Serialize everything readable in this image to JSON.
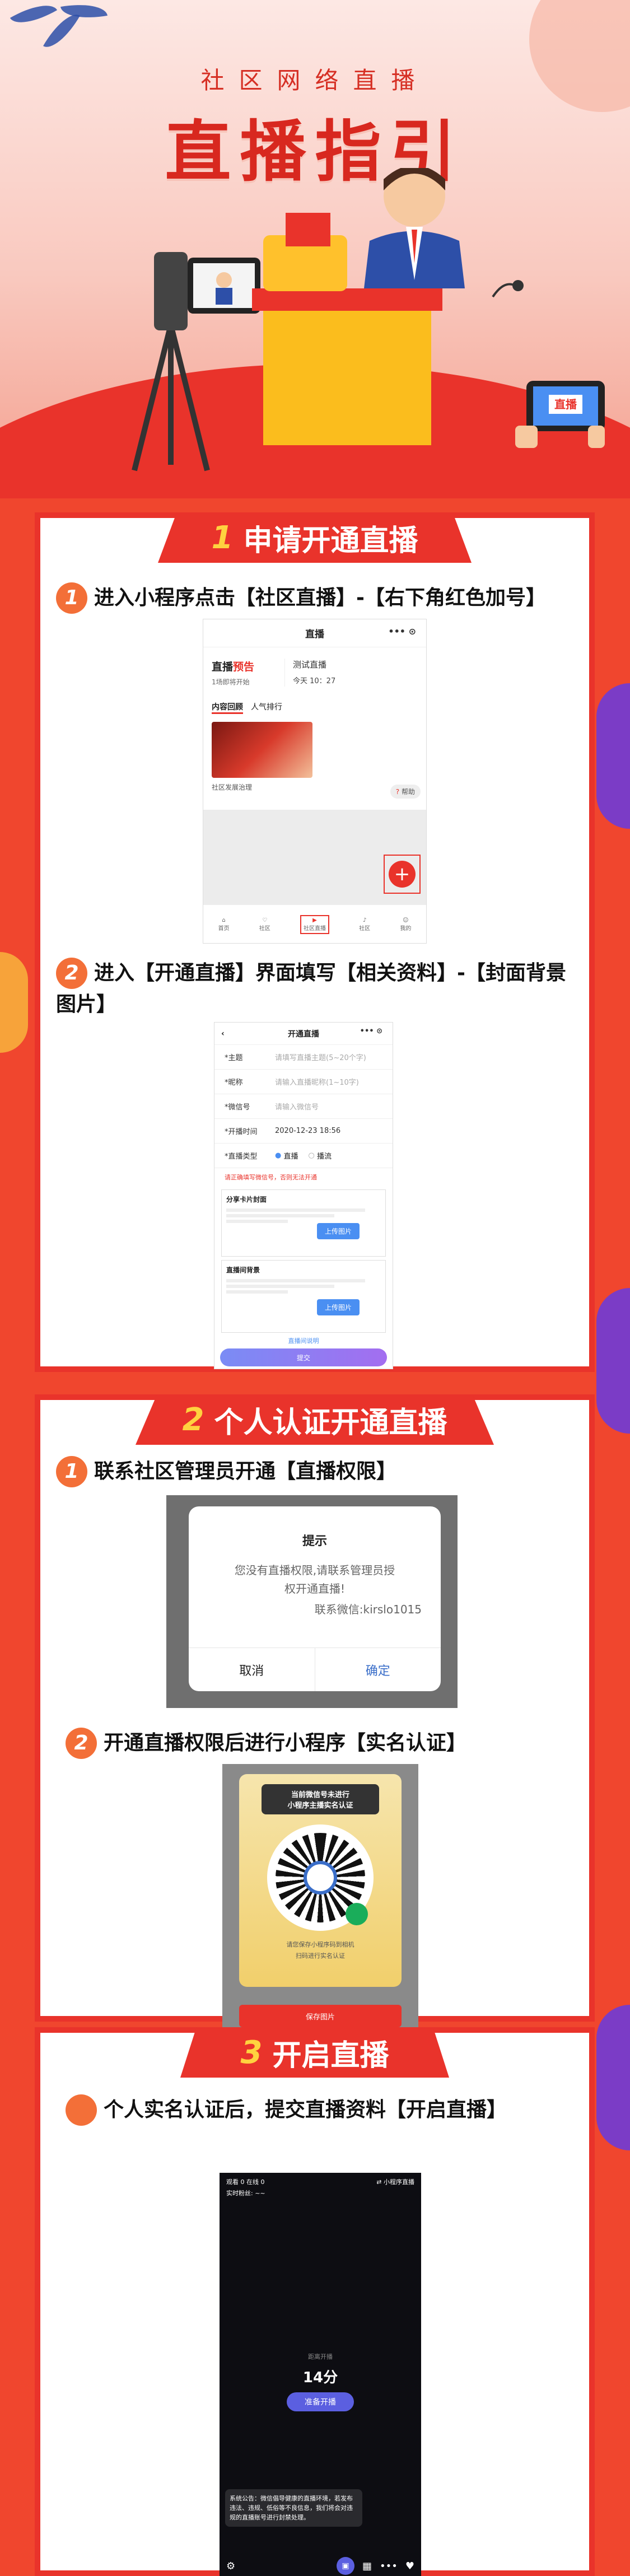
{
  "header": {
    "subtitle": "社区网络直播",
    "title": "直播指引"
  },
  "section1": {
    "num": "1",
    "title": "申请开通直播",
    "step1": {
      "num": "1",
      "text": "进入小程序点击【社区直播】-【右下角红色加号】"
    },
    "step2": {
      "num": "2",
      "text": "进入【开通直播】界面填写【相关资料】-【封面背景图片】"
    },
    "phone1": {
      "title": "直播",
      "brand_a": "直播",
      "brand_b": "预告",
      "brand_sub": "1场即将开始",
      "preview_title": "测试直播",
      "preview_time": "今天 10：27",
      "tab1": "内容回顾",
      "tab2": "人气排行",
      "card_caption": "社区发展治理",
      "help": "帮助",
      "nav": [
        "首页",
        "社区",
        "社区直播",
        "社区",
        "我的"
      ]
    },
    "phone2": {
      "title": "开通直播",
      "fields": [
        {
          "k": "*主题",
          "v": "请填写直播主题(5~20个字)"
        },
        {
          "k": "*昵称",
          "v": "请输入直播昵称(1~10字)"
        },
        {
          "k": "*微信号",
          "v": "请输入微信号"
        },
        {
          "k": "*开播时间",
          "v": "2020-12-23 18:56"
        }
      ],
      "type_label": "*直播类型",
      "type_opt1": "直播",
      "type_opt2": "播流",
      "warn": "请正确填写微信号，否则无法开通",
      "cover1_title": "分享卡片封面",
      "cover2_title": "直播间背景",
      "upload": "上传图片",
      "submit": "提交",
      "more": "直播间说明"
    }
  },
  "section2": {
    "num": "2",
    "title": "个人认证开通直播",
    "step1": {
      "num": "1",
      "text": "联系社区管理员开通【直播权限】"
    },
    "step2": {
      "num": "2",
      "text": "开通直播权限后进行小程序【实名认证】"
    },
    "dialog": {
      "title": "提示",
      "body1": "您没有直播权限,请联系管理员授",
      "body2": "权开通直播!",
      "contact": "联系微信:kirslo1015",
      "cancel": "取消",
      "confirm": "确定"
    },
    "qr": {
      "head1": "当前微信号未进行",
      "head2": "小程序主播实名认证",
      "foot1": "请您保存小程序码到相机",
      "foot2": "扫码进行实名认证",
      "save": "保存图片"
    }
  },
  "section3": {
    "num": "3",
    "title": "开启直播",
    "step1": {
      "text": "个人实名认证后，提交直播资料【开启直播】"
    },
    "phone": {
      "top_left": "观看 0   在线 0",
      "top_right": "小程序直播",
      "top_sub": "实时粉丝: ~~",
      "countdown_label": "距离开播",
      "countdown": "14分",
      "start_btn": "准备开播",
      "notice": "系统公告：微信倡导健康的直播环境，若发布违法、违规、低俗等不良信息，我们将会对违规的直播账号进行封禁处理。"
    }
  }
}
